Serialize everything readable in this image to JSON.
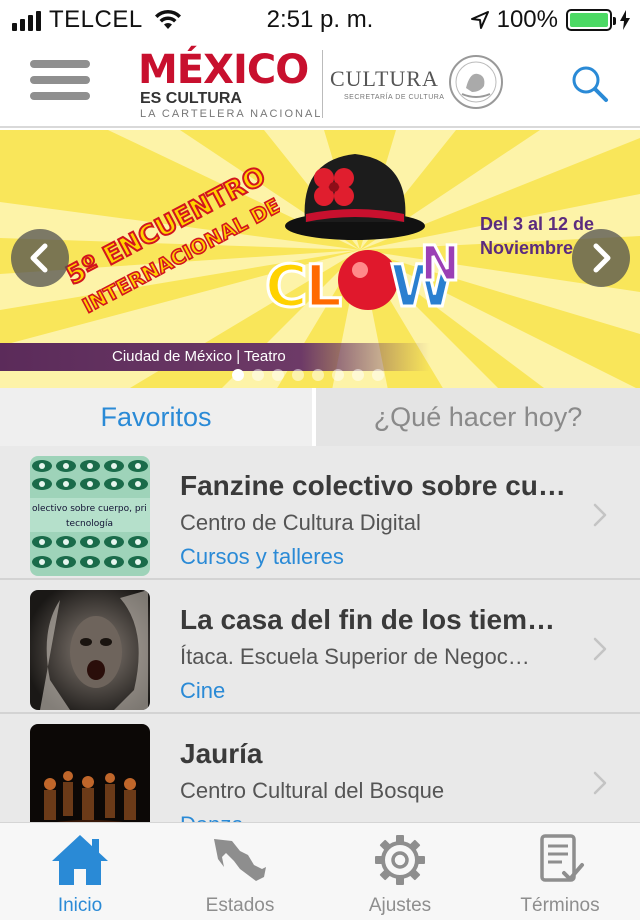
{
  "status_bar": {
    "carrier": "TELCEL",
    "time": "2:51 p. m.",
    "battery": "100%",
    "battery_color": "#4cd964"
  },
  "header": {
    "logo_mexico": "MÉXICO",
    "logo_es_cultura": "ES CULTURA",
    "logo_cartelera": "LA CARTELERA NACIONAL",
    "logo_cultura": "CULTURA",
    "logo_secretaria": "SECRETARÍA DE CULTURA",
    "menu_icon": "hamburger-menu-icon",
    "search_icon": "search-icon"
  },
  "banner": {
    "title_line1": "5º ENCUENTRO",
    "title_line2": "INTERNACIONAL DE",
    "title_line3": "CLOWN",
    "dates_line1": "Del 3 al 12 de",
    "dates_line2": "Noviembre",
    "caption": "Ciudad de México  |  Teatro",
    "slide_count": 8,
    "active_slide": 1
  },
  "tabs": {
    "favoritos": "Favoritos",
    "que_hacer": "¿Qué hacer hoy?"
  },
  "events": [
    {
      "title": "Fanzine colectivo sobre cue…",
      "venue": "Centro de Cultura Digital",
      "category": "Cursos y talleres",
      "thumb_text_line1": "olectivo sobre cuerpo, pri",
      "thumb_text_line2": "tecnología"
    },
    {
      "title": "La casa del fin de los tiempos",
      "venue": "Ítaca. Escuela Superior de Negoc…",
      "category": "Cine"
    },
    {
      "title": "Jauría",
      "venue": "Centro Cultural del Bosque",
      "category": "Danza"
    }
  ],
  "tabbar": {
    "inicio": "Inicio",
    "estados": "Estados",
    "ajustes": "Ajustes",
    "terminos": "Términos",
    "active_color": "#2a8ad6",
    "inactive_color": "#8e8e8e"
  },
  "colors": {
    "accent": "#2a8ad6",
    "brand_red": "#c8102e"
  }
}
